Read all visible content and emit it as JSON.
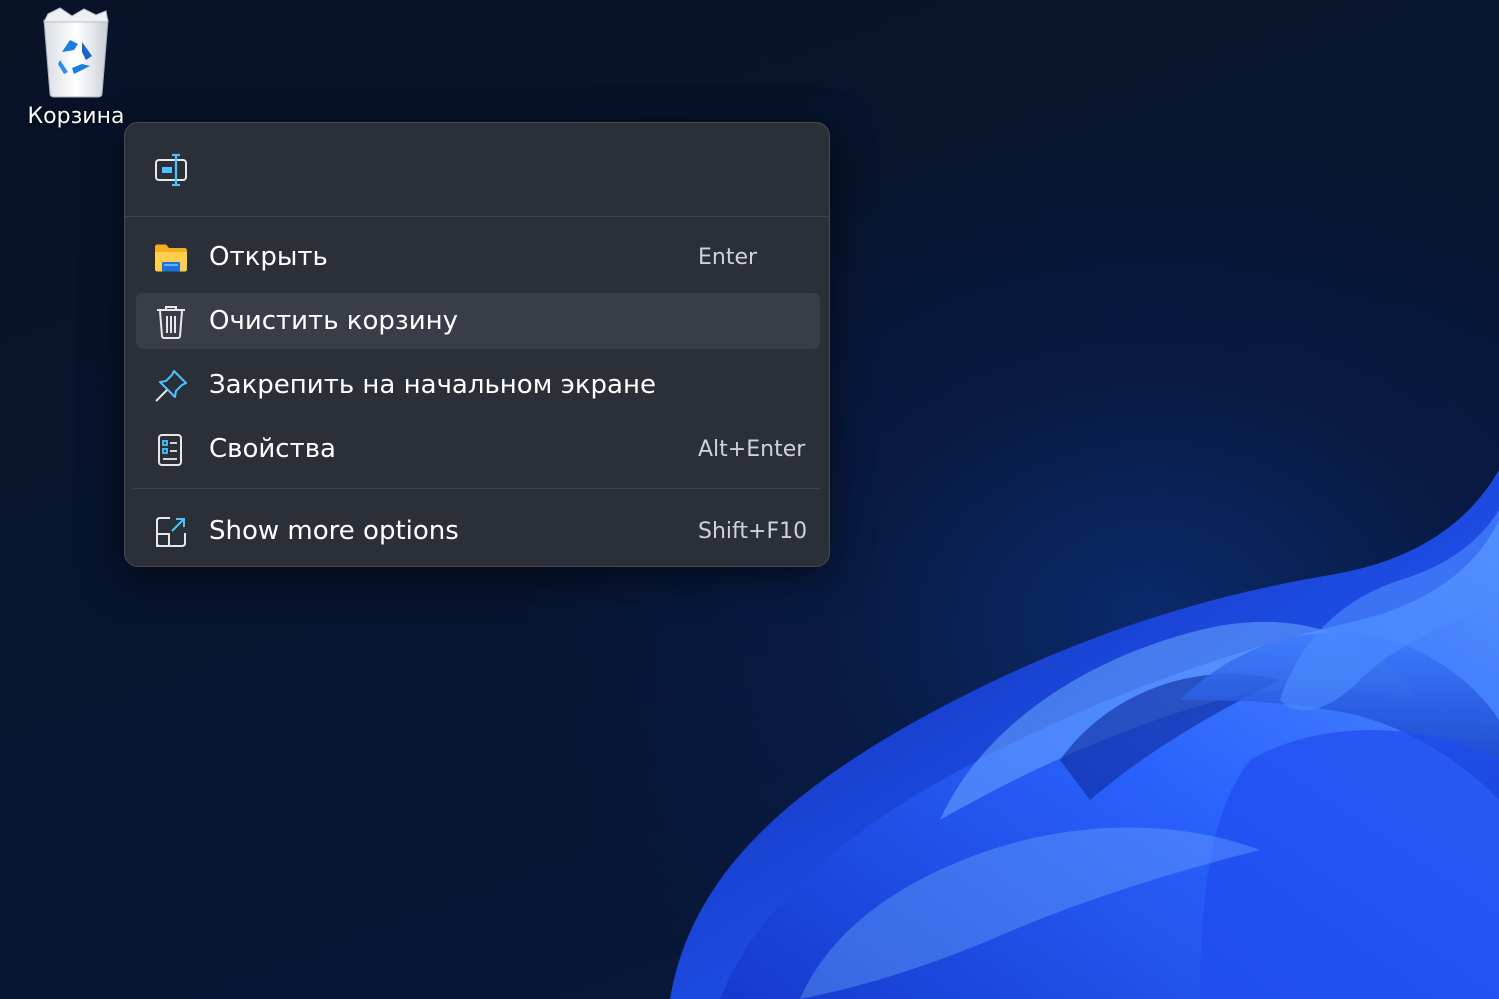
{
  "desktop": {
    "recycle_bin_label": "Корзина"
  },
  "context_menu": {
    "top_actions": [
      {
        "icon": "rename-icon"
      }
    ],
    "items": [
      {
        "label": "Открыть",
        "shortcut": "Enter",
        "icon": "folder-icon"
      },
      {
        "label": "Очистить корзину",
        "shortcut": "",
        "icon": "trash-icon",
        "highlighted": true
      },
      {
        "label": "Закрепить на начальном экране",
        "shortcut": "",
        "icon": "pin-icon"
      },
      {
        "label": "Свойства",
        "shortcut": "Alt+Enter",
        "icon": "properties-icon"
      },
      {
        "label": "Show more options",
        "shortcut": "Shift+F10",
        "icon": "show-more-options-icon"
      }
    ]
  },
  "colors": {
    "menu_background": "#2b2f38",
    "menu_highlight": "#383d48",
    "accent_blue": "#4cc2ff",
    "folder_yellow": "#f8c33b",
    "wallpaper_blue": "#1f5bff"
  }
}
